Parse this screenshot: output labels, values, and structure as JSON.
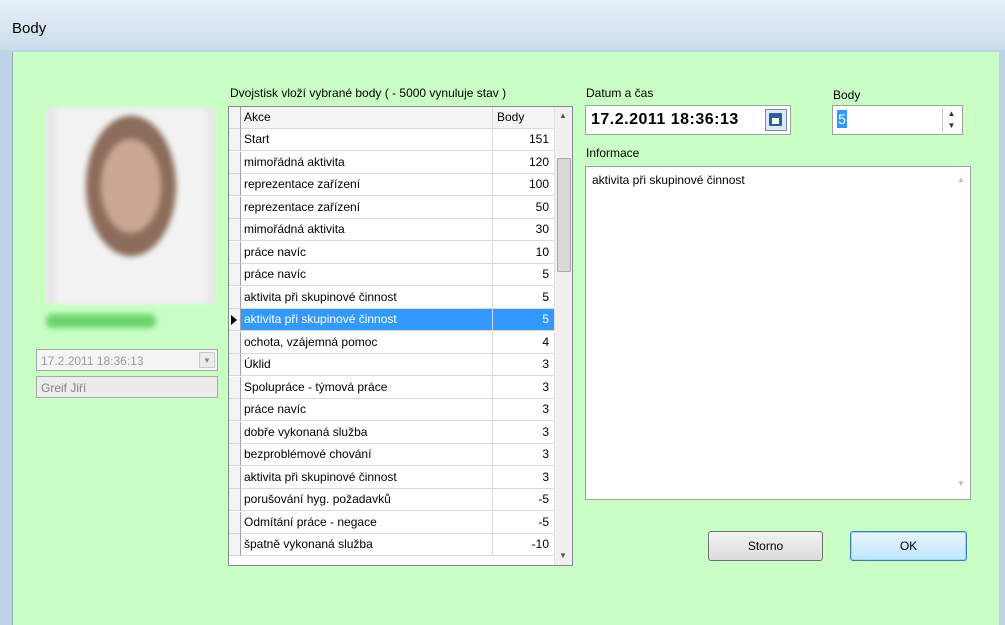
{
  "window": {
    "title": "Body"
  },
  "left": {
    "combo_value": "17.2.2011 18:36:13",
    "combo_arrow": "chevron-down-icon",
    "readonly_name": "Greif Jiří"
  },
  "grid": {
    "caption": "Dvojstisk vloží vybrané body ( - 5000 vynuluje stav )",
    "columns": [
      "Akce",
      "Body"
    ],
    "selected_index": 8,
    "rows": [
      {
        "action": "Start",
        "points": "151"
      },
      {
        "action": "mimořádná aktivita",
        "points": "120"
      },
      {
        "action": "reprezentace zařízení",
        "points": "100"
      },
      {
        "action": "reprezentace zařízení",
        "points": "50"
      },
      {
        "action": "mimořádná aktivita",
        "points": "30"
      },
      {
        "action": "práce navíc",
        "points": "10"
      },
      {
        "action": "práce navíc",
        "points": "5"
      },
      {
        "action": "aktivita při skupinové činnost",
        "points": "5"
      },
      {
        "action": "aktivita při skupinové činnost",
        "points": "5"
      },
      {
        "action": "ochota, vzájemná pomoc",
        "points": "4"
      },
      {
        "action": "Úklid",
        "points": "3"
      },
      {
        "action": "Spolupráce - týmová práce",
        "points": "3"
      },
      {
        "action": "práce navíc",
        "points": "3"
      },
      {
        "action": "dobře vykonaná služba",
        "points": "3"
      },
      {
        "action": "bezproblémové chování",
        "points": "3"
      },
      {
        "action": "aktivita při skupinové činnost",
        "points": "3"
      },
      {
        "action": "porušování hyg. požadavků",
        "points": "-5"
      },
      {
        "action": "Odmítání práce - negace",
        "points": "-5"
      },
      {
        "action": "špatně vykonaná služba",
        "points": "-10"
      }
    ]
  },
  "datetime": {
    "label": "Datum a čas",
    "value": "17.2.2011 18:36:13",
    "button_icon": "calendar-icon"
  },
  "points": {
    "label": "Body",
    "value": "5"
  },
  "info": {
    "label": "Informace",
    "text": "aktivita při skupinové činnost"
  },
  "buttons": {
    "cancel": "Storno",
    "ok": "OK"
  },
  "colors": {
    "client_bg": "#c9ffc5",
    "selection": "#3399ff"
  }
}
